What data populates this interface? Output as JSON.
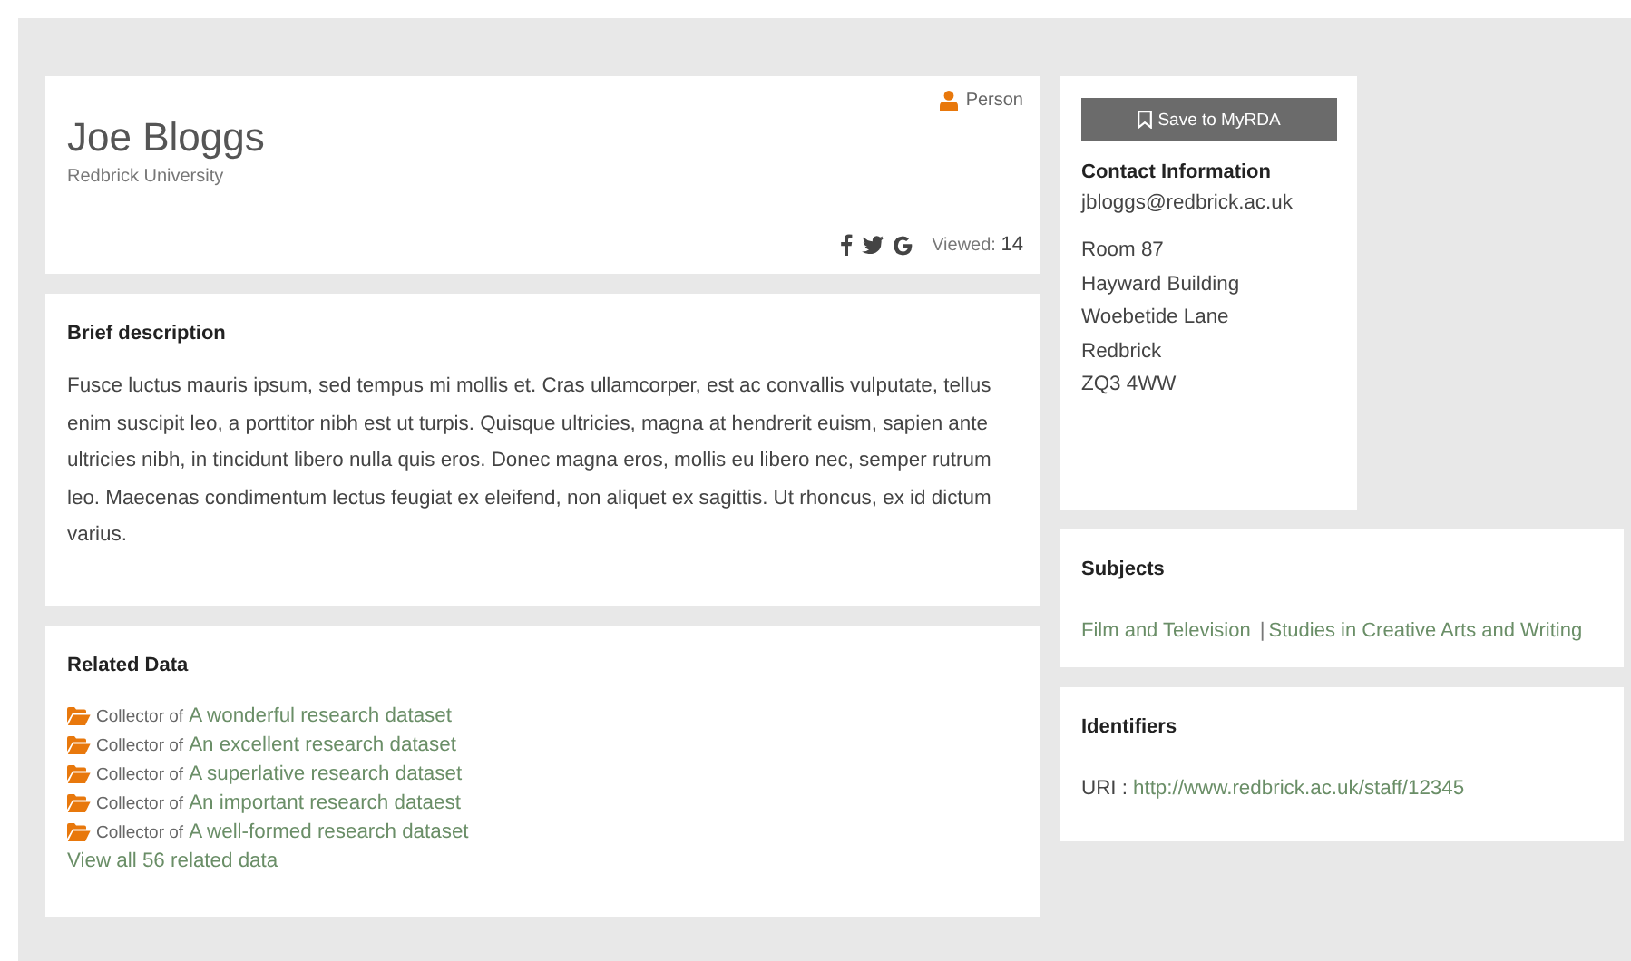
{
  "profile": {
    "type_label": "Person",
    "name": "Joe Bloggs",
    "organisation": "Redbrick University",
    "viewed_label": "Viewed:",
    "viewed_count": "14"
  },
  "description": {
    "heading": "Brief description",
    "text": "Fusce luctus mauris ipsum, sed tempus mi mollis et. Cras ullamcorper, est ac convallis vulputate, tellus enim suscipit leo, a porttitor nibh est ut turpis. Quisque ultricies, magna at hendrerit  euism, sapien ante ultricies nibh, in tincidunt libero nulla quis eros. Donec magna eros, mollis eu libero nec, semper rutrum leo. Maecenas condimentum lectus feugiat ex eleifend, non aliquet ex sagittis. Ut rhoncus, ex id dictum varius."
  },
  "related": {
    "heading": "Related Data",
    "items": [
      {
        "role": "Collector of",
        "title": "A wonderful research dataset"
      },
      {
        "role": "Collector of",
        "title": "An excellent research dataset"
      },
      {
        "role": "Collector of",
        "title": "A superlative research dataset"
      },
      {
        "role": "Collector of",
        "title": "An important research dataest"
      },
      {
        "role": "Collector of",
        "title": "A well-formed research dataset"
      }
    ],
    "view_all": "View all 56 related data"
  },
  "contact": {
    "save_button": "Save to MyRDA",
    "heading": "Contact Information",
    "email": "jbloggs@redbrick.ac.uk",
    "address": [
      "Room 87",
      "Hayward Building",
      "Woebetide Lane",
      "Redbrick",
      "ZQ3 4WW"
    ]
  },
  "subjects": {
    "heading": "Subjects",
    "items": [
      "Film and Television",
      "Studies in Creative Arts and Writing"
    ],
    "separator": "|"
  },
  "identifiers": {
    "heading": "Identifiers",
    "items": [
      {
        "label": "URI :",
        "value": "http://www.redbrick.ac.uk/staff/12345"
      }
    ]
  }
}
